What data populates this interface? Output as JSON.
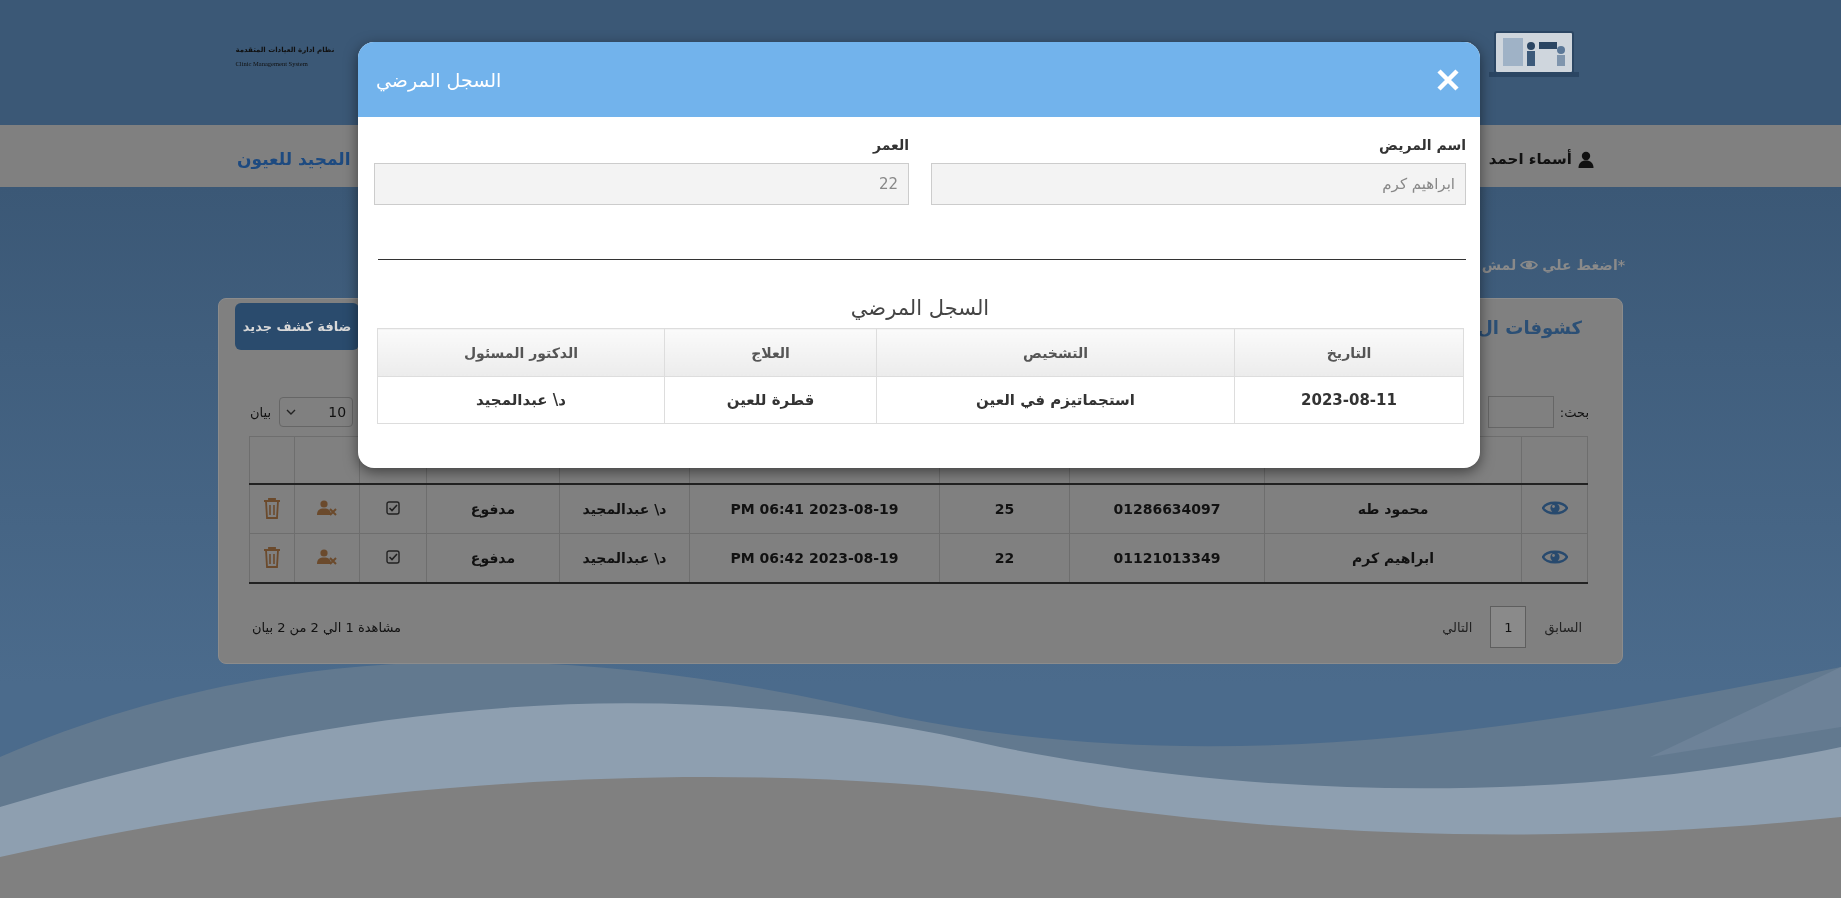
{
  "header": {
    "logo_title": "نظام ادارة العيادات المتقدمة",
    "logo_subtitle": "Clinic Management System"
  },
  "nav": {
    "user_name": "أسماء احمد",
    "clinic_name": "المجيد للعيون"
  },
  "hint": {
    "before": "*اضغط علي",
    "after": "لمش"
  },
  "card": {
    "title": "كشوفات ال",
    "add_button": "ضافة كشف جديد",
    "search_label": "بحث:",
    "page_size": "10",
    "page_size_label": "بيان",
    "rows": [
      {
        "name": "محمود طه",
        "phone": "01286634097",
        "age": "25",
        "date": "2023-08-19 06:41 PM",
        "doctor": "د\\ عبدالمجيد",
        "payment": "مدفوع"
      },
      {
        "name": "ابراهيم كرم",
        "phone": "01121013349",
        "age": "22",
        "date": "2023-08-19 06:42 PM",
        "doctor": "د\\ عبدالمجيد",
        "payment": "مدفوع"
      }
    ],
    "info": "مشاهدة 1 الي 2 من 2 بيان",
    "pagination": {
      "previous": "السابق",
      "pages": [
        {
          "label": "1",
          "selected": true
        }
      ],
      "next": "التالي"
    }
  },
  "modal": {
    "title": "السجل المرضي",
    "fields": [
      {
        "label": "اسم المريض",
        "value": "ابراهيم كرم",
        "disabled": true
      },
      {
        "label": "العمر",
        "value": "22",
        "disabled": true
      }
    ],
    "record_title": "السجل المرضي",
    "record_table": {
      "columns": [
        "التاريخ",
        "التشخيص",
        "العلاج",
        "الدكتور المسئول"
      ],
      "rows": [
        [
          "2023-08-11",
          "استجماتيزم في العين",
          "قطرة للعين",
          "د\\ عبدالمجيد"
        ]
      ]
    }
  }
}
